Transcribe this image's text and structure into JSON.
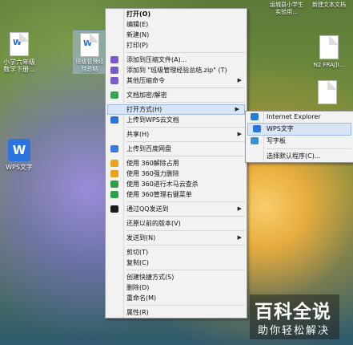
{
  "desktop": {
    "icons": [
      {
        "label": "小学六年级数学下册...",
        "kind": "doc"
      },
      {
        "label": "班级管理经验总结",
        "kind": "doc-selected"
      },
      {
        "label": "WPS文字",
        "kind": "wps"
      },
      {
        "label": "运城县小学生实验用...",
        "kind": "doc"
      },
      {
        "label": "新建文本文档",
        "kind": "doc"
      },
      {
        "label": "N2 FRAJ]I...",
        "kind": "doc"
      }
    ]
  },
  "context_menu": {
    "items": [
      {
        "label": "打开(O)",
        "bold": true
      },
      {
        "label": "编辑(E)"
      },
      {
        "label": "新建(N)"
      },
      {
        "label": "打印(P)"
      },
      {
        "sep": true
      },
      {
        "label": "添加到压缩文件(A)...",
        "icon": "archive-icon",
        "color": "#7a5ac8"
      },
      {
        "label": "添加到 \"班级管理经验总结.zip\" (T)",
        "icon": "archive-icon",
        "color": "#7a5ac8"
      },
      {
        "label": "其他压缩命令",
        "icon": "archive-icon",
        "color": "#7a5ac8",
        "submenu": true
      },
      {
        "sep": true
      },
      {
        "label": "文档加密/解密",
        "icon": "shield-icon",
        "color": "#3aa35a"
      },
      {
        "sep": true
      },
      {
        "label": "打开方式(H)",
        "submenu": true,
        "hot": true
      },
      {
        "label": "上传到WPS云文档",
        "icon": "cloud-icon",
        "color": "#2b73df"
      },
      {
        "sep": true
      },
      {
        "label": "共享(H)",
        "submenu": true
      },
      {
        "sep": true
      },
      {
        "label": "上传到百度网盘",
        "icon": "baidu-icon",
        "color": "#3a7ae0"
      },
      {
        "sep": true
      },
      {
        "label": "使用 360解除占用",
        "icon": "360-icon",
        "color": "#e9a21a"
      },
      {
        "label": "使用 360强力删除",
        "icon": "360-icon",
        "color": "#e9a21a"
      },
      {
        "label": "使用 360进行木马云查杀",
        "icon": "360-icon",
        "color": "#2fa046"
      },
      {
        "label": "使用 360管理右键菜单",
        "icon": "360-icon",
        "color": "#2fa046"
      },
      {
        "sep": true
      },
      {
        "label": "通过QQ发送到",
        "icon": "qq-icon",
        "color": "#1a1a1a",
        "submenu": true
      },
      {
        "sep": true
      },
      {
        "label": "还原以前的版本(V)"
      },
      {
        "sep": true
      },
      {
        "label": "发送到(N)",
        "submenu": true
      },
      {
        "sep": true
      },
      {
        "label": "剪切(T)"
      },
      {
        "label": "复制(C)"
      },
      {
        "sep": true
      },
      {
        "label": "创建快捷方式(S)"
      },
      {
        "label": "删除(D)"
      },
      {
        "label": "重命名(M)"
      },
      {
        "sep": true
      },
      {
        "label": "属性(R)"
      }
    ]
  },
  "open_with_submenu": {
    "items": [
      {
        "label": "Internet Explorer",
        "icon": "ie-icon",
        "color": "#1e7fd8"
      },
      {
        "label": "WPS文字",
        "icon": "wps-icon",
        "color": "#2b73df",
        "hot": true
      },
      {
        "label": "写字板",
        "icon": "wordpad-icon",
        "color": "#3b8fd8"
      },
      {
        "sep": true
      },
      {
        "label": "选择默认程序(C)..."
      }
    ]
  },
  "watermark": {
    "title": "百科全说",
    "subtitle": "助你轻松解决"
  }
}
